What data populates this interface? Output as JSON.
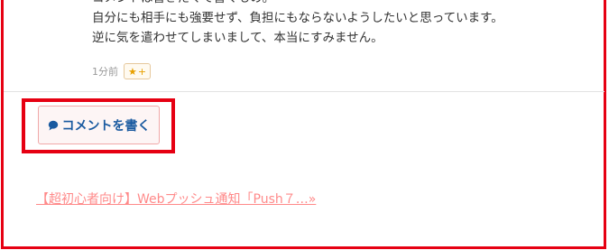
{
  "comment": {
    "lines": [
      "コメントは書きたくて書くもの。",
      "自分にも相手にも強要せず、負担にもならないようしたいと思っています。",
      "逆に気を遣わせてしまいまして、本当にすみません。"
    ],
    "time": "1分前",
    "fav_plus": "+",
    "fav_icon": "star-icon"
  },
  "write_comment": {
    "label": "コメントを書く",
    "icon": "speech-bubble-icon"
  },
  "next_article": {
    "label": "【超初心者向け】Webプッシュ通知「Push７…»"
  },
  "colors": {
    "highlight": "#e60012",
    "button_text": "#1a5aa0",
    "link": "#ff8a8a",
    "star": "#e8a000"
  }
}
